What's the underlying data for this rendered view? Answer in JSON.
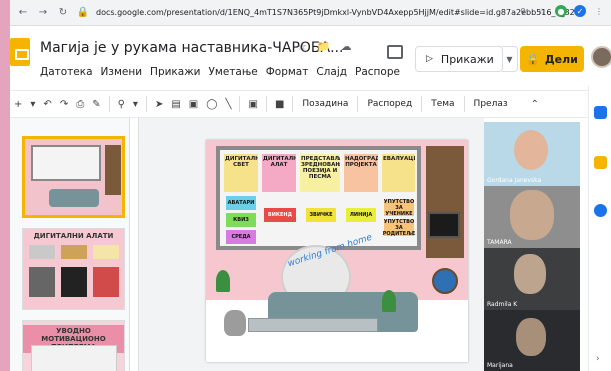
{
  "browser": {
    "url": "docs.google.com/presentation/d/1ENQ_4mT1S7N365Pt9jDmkxl-VynbVD4Axepp5HjjM/edit#slide=id.g87a2ebb516_0_82",
    "back_icon": "arrow-left-icon",
    "forward_icon": "arrow-right-icon",
    "reload_icon": "reload-icon"
  },
  "header": {
    "title": "Магија је у рукама наставника-ЧАРОБА...",
    "menu": [
      "Датотека",
      "Измени",
      "Прикажи",
      "Уметање",
      "Формат",
      "Слајд",
      "Распоре"
    ],
    "present_label": "Прикажи",
    "share_label": "Дели"
  },
  "toolbar": {
    "background_label": "Позадина",
    "layout_label": "Распоред",
    "theme_label": "Тема",
    "transition_label": "Прелаз"
  },
  "filmstrip": {
    "thumbs": [
      {
        "number": "",
        "title": ""
      },
      {
        "number": "",
        "title": "ДИГИТАЛНИ АЛАТИ"
      },
      {
        "number": "",
        "title": "УВОДНО МОТИВАЦИОНО ПРИПРЕМА"
      }
    ]
  },
  "slide": {
    "columns": [
      "ДИГИТАЛНИ СВЕТ",
      "ДИГИТАЛНИ АЛАТ",
      "ПРЕДСТАВЉАЊЕ ЗРЕДНОВАЊА, ПОЕЗИЈА И ПЕСМА",
      "НАДОГРАДЊА ПРОЈЕКТА",
      "ЕВАЛУАЦИЈА"
    ],
    "stickers": {
      "avatari": "АВАТАРИ",
      "kviz": "КВИЗ",
      "vikend": "ВИКЕНД",
      "zivotinje": "ЗВИЧКЕ",
      "timeline": "ЛИНИЈА",
      "uputstvo_roditelji": "УПУТСТВО ЗА РОДИТЕЉЕ",
      "uputstvo_ucenike": "УПУТСТВО ЗА УЧЕНИКЕ",
      "sreda": "СРЕДА"
    },
    "wfh_text": "working from home"
  },
  "video": {
    "participants": [
      {
        "name": "Gordana Janevska"
      },
      {
        "name": "TAMARA"
      },
      {
        "name": "Radmila K"
      },
      {
        "name": "Marijana"
      }
    ]
  }
}
